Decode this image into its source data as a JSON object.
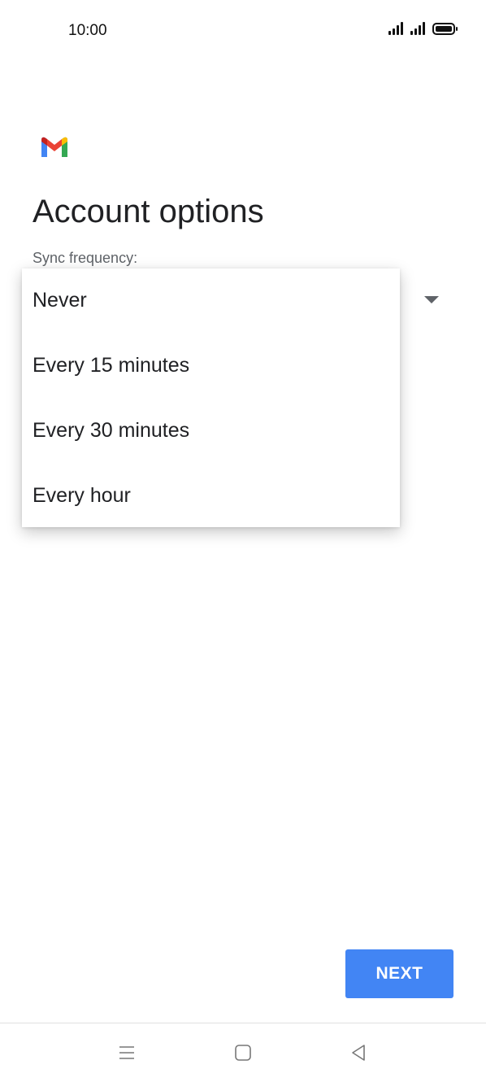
{
  "status_bar": {
    "time": "10:00",
    "icons": [
      "signal-icon",
      "signal-icon",
      "battery-icon"
    ]
  },
  "app": {
    "logo": "gmail-logo",
    "brand_colors": {
      "blue": "#4285F4",
      "red": "#EA4335",
      "yellow": "#FBBC04",
      "green": "#34A853"
    }
  },
  "page": {
    "title": "Account options",
    "sync_label": "Sync frequency:"
  },
  "sync_menu": {
    "options": [
      {
        "label": "Never"
      },
      {
        "label": "Every 15 minutes"
      },
      {
        "label": "Every 30 minutes"
      },
      {
        "label": "Every hour"
      }
    ]
  },
  "actions": {
    "next_label": "NEXT",
    "next_color": "#4285F4"
  },
  "nav_bar": {
    "icons": [
      "menu-icon",
      "home-icon",
      "back-icon"
    ]
  }
}
